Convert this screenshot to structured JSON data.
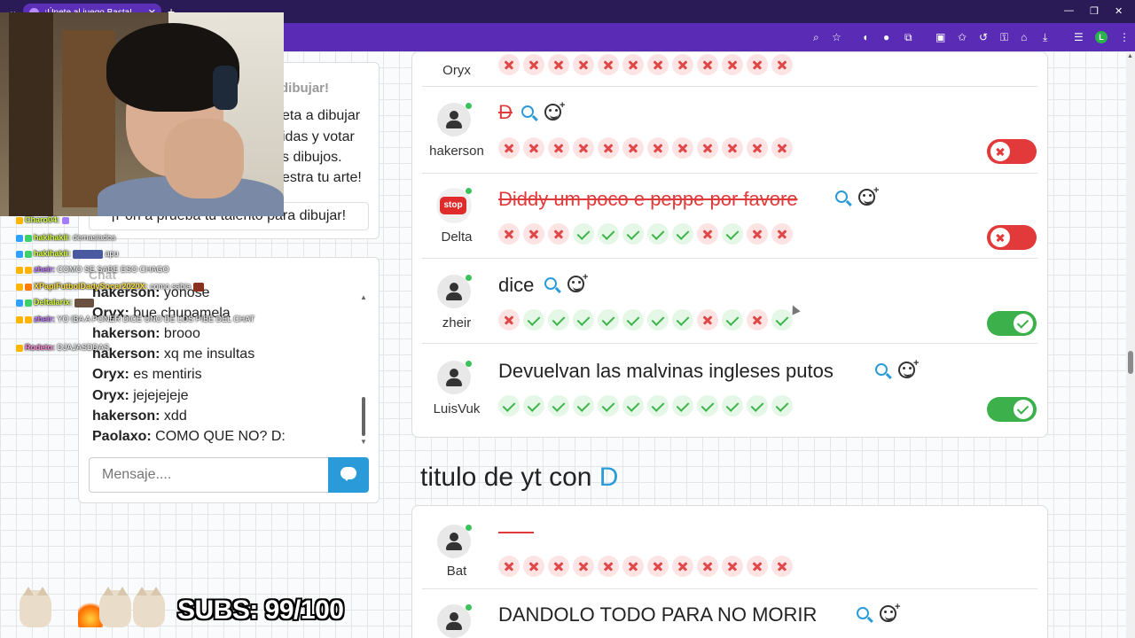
{
  "browser": {
    "tab_title": "¡Únete al juego Basta!",
    "avatar_letter": "L"
  },
  "draw_panel": {
    "title": "dibujar!",
    "lines": [
      "eta a dibujar",
      "idas y votar",
      "s dibujos.",
      "estra tu arte!"
    ],
    "banner": "¡Pon a prueba tu talento para dibujar!"
  },
  "chat": {
    "title": "Chat",
    "messages": [
      {
        "user": "hakerson:",
        "text": "yonose"
      },
      {
        "user": "Oryx:",
        "text": "bue chupamela"
      },
      {
        "user": "hakerson:",
        "text": "brooo"
      },
      {
        "user": "hakerson:",
        "text": "xq me insultas"
      },
      {
        "user": "Oryx:",
        "text": "es mentiris"
      },
      {
        "user": "Oryx:",
        "text": "jejejejeje"
      },
      {
        "user": "hakerson:",
        "text": "xdd"
      },
      {
        "user": "Paolaxo:",
        "text": "COMO QUE NO? D:"
      }
    ],
    "input_placeholder": "Mensaje...."
  },
  "stream_overlay": {
    "lines": [
      {
        "name": "Charo04:",
        "msg": ""
      },
      {
        "name": "hakihakii:",
        "msg": "demasiados"
      },
      {
        "name": "hakihakii:",
        "msg": "apu"
      },
      {
        "name": "zheir:",
        "msg": "COMO SE SABE ESO CHAGO"
      },
      {
        "name": "XPapiFutbolDadySocer2020X:",
        "msg": "como sabia"
      },
      {
        "name": "Deltalarix:",
        "msg": ""
      },
      {
        "name": "zheir:",
        "msg": "YO IBA A PONER DICE UNO DE LOS PIBE DEL CHAT"
      },
      {
        "name": "Rodeto:",
        "msg": "DJAJASDDAS"
      }
    ],
    "subs_label": "SUBS: 99/100"
  },
  "rounds": {
    "round1_rows": [
      {
        "player": "Oryx",
        "answer": "",
        "votes": "nnnnnnnnnnnn",
        "toggle": "none"
      },
      {
        "player": "hakerson",
        "answer": "D",
        "struck": true,
        "votes": "nnnnnnnnnnnn",
        "toggle": "off"
      },
      {
        "player": "Delta",
        "answer": "Diddy um poco e peppe por favore",
        "struck": true,
        "stop_label": "stop",
        "votes": "nnnyyyyynynn",
        "toggle": "off"
      },
      {
        "player": "zheir",
        "answer": "dice",
        "struck": false,
        "votes": "nyyyyyyynyny",
        "toggle": "on"
      },
      {
        "player": "LuisVuk",
        "answer": "Devuelvan las malvinas ingleses putos",
        "struck": false,
        "votes": "yyyyyyyyyyyy",
        "toggle": "on"
      }
    ],
    "section2_title": "titulo de yt con",
    "section2_letter": "D",
    "round2_rows": [
      {
        "player": "Bat",
        "answer": "",
        "votes": "nnnnnnnnnnnn"
      },
      {
        "player": "",
        "answer": "DANDOLO TODO PARA NO MORIR"
      }
    ]
  }
}
